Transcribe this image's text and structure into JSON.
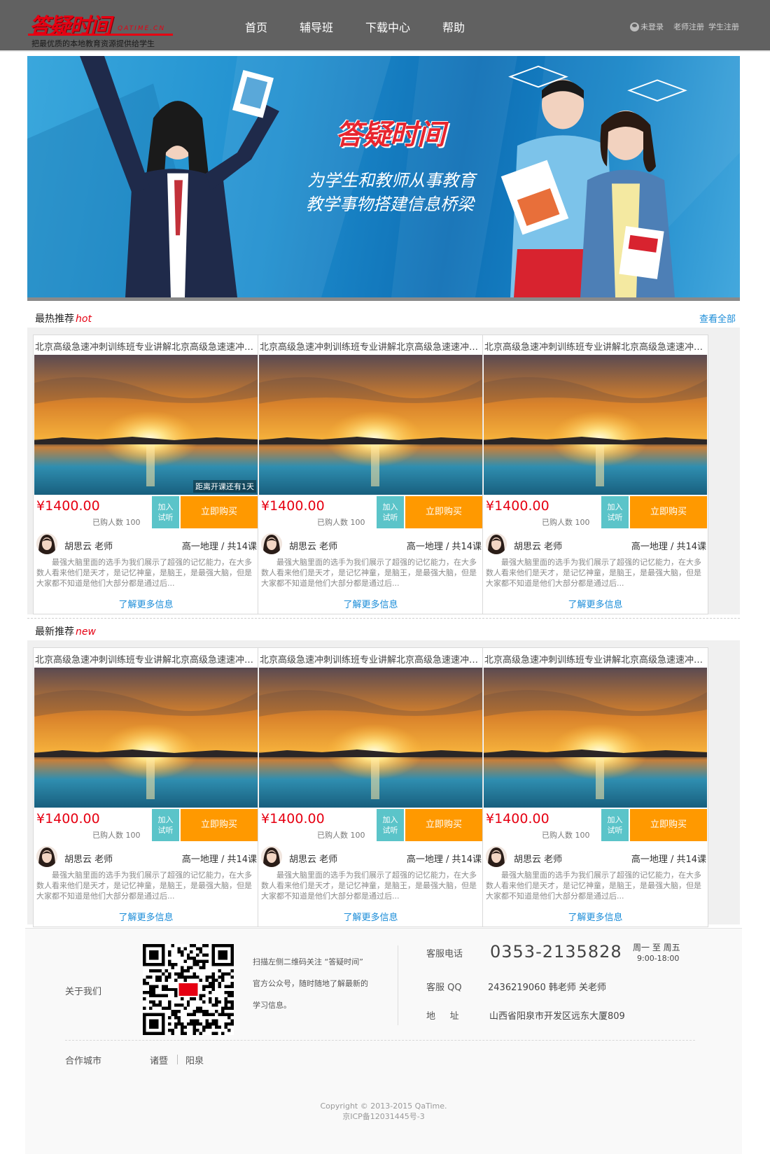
{
  "header": {
    "logo_text": "答疑时间",
    "logo_domain": "QATIME.CN",
    "slogan": "把最优质的本地教育资源提供给学生",
    "nav": [
      "首页",
      "辅导班",
      "下载中心",
      "帮助"
    ],
    "login": "未登录",
    "teacher_register": "老师注册",
    "student_register": "学生注册"
  },
  "banner": {
    "title": "答疑时间",
    "line1": "为学生和教师从事教育",
    "line2": "教学事物搭建信息桥梁"
  },
  "hot": {
    "title": "最热推荐",
    "tag": "hot",
    "view_all": "查看全部",
    "countdown": "距离开课还有1天",
    "cards": [
      {
        "title": "北京高级急速冲刺训练班专业讲解北京高级急速速冲刺训练班",
        "price": "¥1400.00",
        "buyers": "已购人数 100",
        "trial": "加入试听",
        "buy": "立即购买",
        "teacher": "胡思云 老师",
        "meta": "高一地理  /  共14课",
        "desc": "最强大脑里面的选手为我们展示了超强的记忆能力，在大多数人看来他们是天才，是记忆神童，是脑王，是最强大脑，但是大家都不知道是他们大部分都是通过后...",
        "more": "了解更多信息"
      },
      {
        "title": "北京高级急速冲刺训练班专业讲解北京高级急速速冲刺训练班",
        "price": "¥1400.00",
        "buyers": "已购人数 100",
        "trial": "加入试听",
        "buy": "立即购买",
        "teacher": "胡思云 老师",
        "meta": "高一地理  /  共14课",
        "desc": "最强大脑里面的选手为我们展示了超强的记忆能力，在大多数人看来他们是天才，是记忆神童，是脑王，是最强大脑，但是大家都不知道是他们大部分都是通过后...",
        "more": "了解更多信息"
      },
      {
        "title": "北京高级急速冲刺训练班专业讲解北京高级急速速冲刺训练班",
        "price": "¥1400.00",
        "buyers": "已购人数 100",
        "trial": "加入试听",
        "buy": "立即购买",
        "teacher": "胡思云 老师",
        "meta": "高一地理  /  共14课",
        "desc": "最强大脑里面的选手为我们展示了超强的记忆能力，在大多数人看来他们是天才，是记忆神童，是脑王，是最强大脑，但是大家都不知道是他们大部分都是通过后...",
        "more": "了解更多信息"
      }
    ]
  },
  "newest": {
    "title": "最新推荐",
    "tag": "new",
    "cards": [
      {
        "title": "北京高级急速冲刺训练班专业讲解北京高级急速速冲刺训练班",
        "price": "¥1400.00",
        "buyers": "已购人数 100",
        "trial": "加入试听",
        "buy": "立即购买",
        "teacher": "胡思云 老师",
        "meta": "高一地理  /  共14课",
        "desc": "最强大脑里面的选手为我们展示了超强的记忆能力，在大多数人看来他们是天才，是记忆神童，是脑王，是最强大脑，但是大家都不知道是他们大部分都是通过后...",
        "more": "了解更多信息"
      },
      {
        "title": "北京高级急速冲刺训练班专业讲解北京高级急速速冲刺训练班",
        "price": "¥1400.00",
        "buyers": "已购人数 100",
        "trial": "加入试听",
        "buy": "立即购买",
        "teacher": "胡思云 老师",
        "meta": "高一地理  /  共14课",
        "desc": "最强大脑里面的选手为我们展示了超强的记忆能力，在大多数人看来他们是天才，是记忆神童，是脑王，是最强大脑，但是大家都不知道是他们大部分都是通过后...",
        "more": "了解更多信息"
      },
      {
        "title": "北京高级急速冲刺训练班专业讲解北京高级急速速冲刺训练班",
        "price": "¥1400.00",
        "buyers": "已购人数 100",
        "trial": "加入试听",
        "buy": "立即购买",
        "teacher": "胡思云 老师",
        "meta": "高一地理  /  共14课",
        "desc": "最强大脑里面的选手为我们展示了超强的记忆能力，在大多数人看来他们是天才，是记忆神童，是脑王，是最强大脑，但是大家都不知道是他们大部分都是通过后...",
        "more": "了解更多信息"
      }
    ]
  },
  "footer": {
    "about": "关于我们",
    "qr_text": "扫描左侧二维码关注 “答疑时间” 官方公众号，随时随地了解最新的学习信息。",
    "phone_label": "客服电话",
    "phone": "0353-2135828",
    "hours_days": "周一 至 周五",
    "hours_time": "9:00-18:00",
    "qq_label": "客服 QQ",
    "qq": "2436219060    韩老师 关老师",
    "addr_label": "地     址",
    "addr": "山西省阳泉市开发区远东大厦809",
    "cities_label": "合作城市",
    "cities": [
      "诸暨",
      "阳泉"
    ],
    "copyright": "Copyright © 2013-2015 QaTime.",
    "icp": "京ICP备12031445号-3"
  },
  "colors": {
    "header_bg": "#616161",
    "brand_red": "#e60012",
    "buy_orange": "#ff9900",
    "trial_teal": "#5bc4c9",
    "link_blue": "#1a8cd8"
  }
}
